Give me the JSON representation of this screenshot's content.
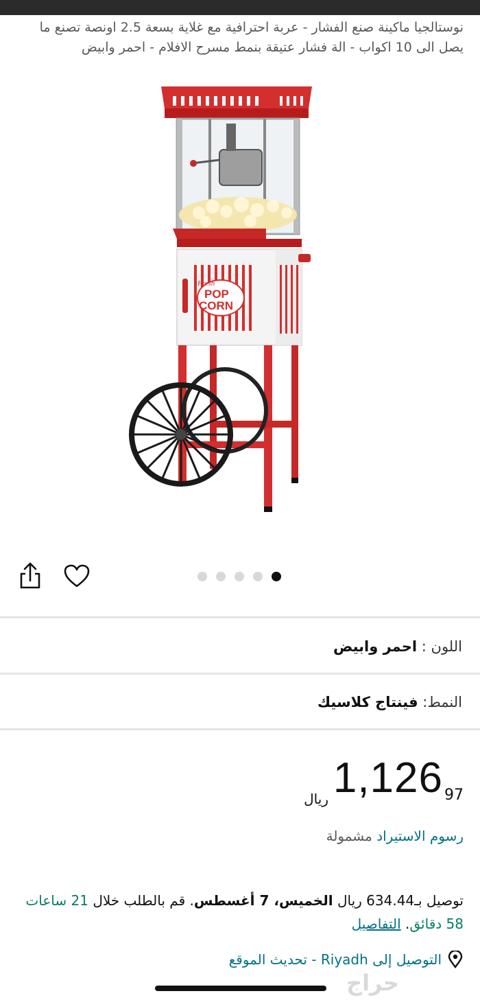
{
  "product": {
    "title": "نوستالجيا ماكينة صنع الفشار - عربة احترافية مع غلاية بسعة 2.5 اونصة تصنع ما يصل الى 10 اكواب - الة فشار عتيقة بنمط مسرح الافلام - احمر وابيض",
    "image": {
      "name": "popcorn-cart-image",
      "sign_text_1": "Fresh",
      "sign_text_2": "POP",
      "sign_text_3": "CORN"
    },
    "gallery": {
      "count": 5,
      "active_index": 4
    }
  },
  "icons": {
    "share": "share-icon",
    "wishlist": "heart-icon",
    "location": "location-pin-icon"
  },
  "attributes": {
    "color_label": "اللون :",
    "color_value": "احمر وابيض",
    "style_label": "النمط:",
    "style_value": "فينتاج كلاسيك"
  },
  "price": {
    "whole": "1,126",
    "fraction": "97",
    "currency": "ريال"
  },
  "import_fees": {
    "link": "رسوم الاستيراد",
    "text": "مشمولة"
  },
  "delivery": {
    "prefix": "توصيل بـ634.44 ريال",
    "date": "الخميس، 7 أغسطس",
    "order_prefix": ". قم بالطلب خلال",
    "countdown": "21 ساعات 58 دقائق",
    "details_link": "التفاصيل"
  },
  "location": {
    "text": "التوصيل إلى Riyadh - تحديث الموقع"
  },
  "watermark": "حراج",
  "colors": {
    "link": "#007185",
    "green": "#067d62",
    "accent_red": "#d32f2f"
  }
}
